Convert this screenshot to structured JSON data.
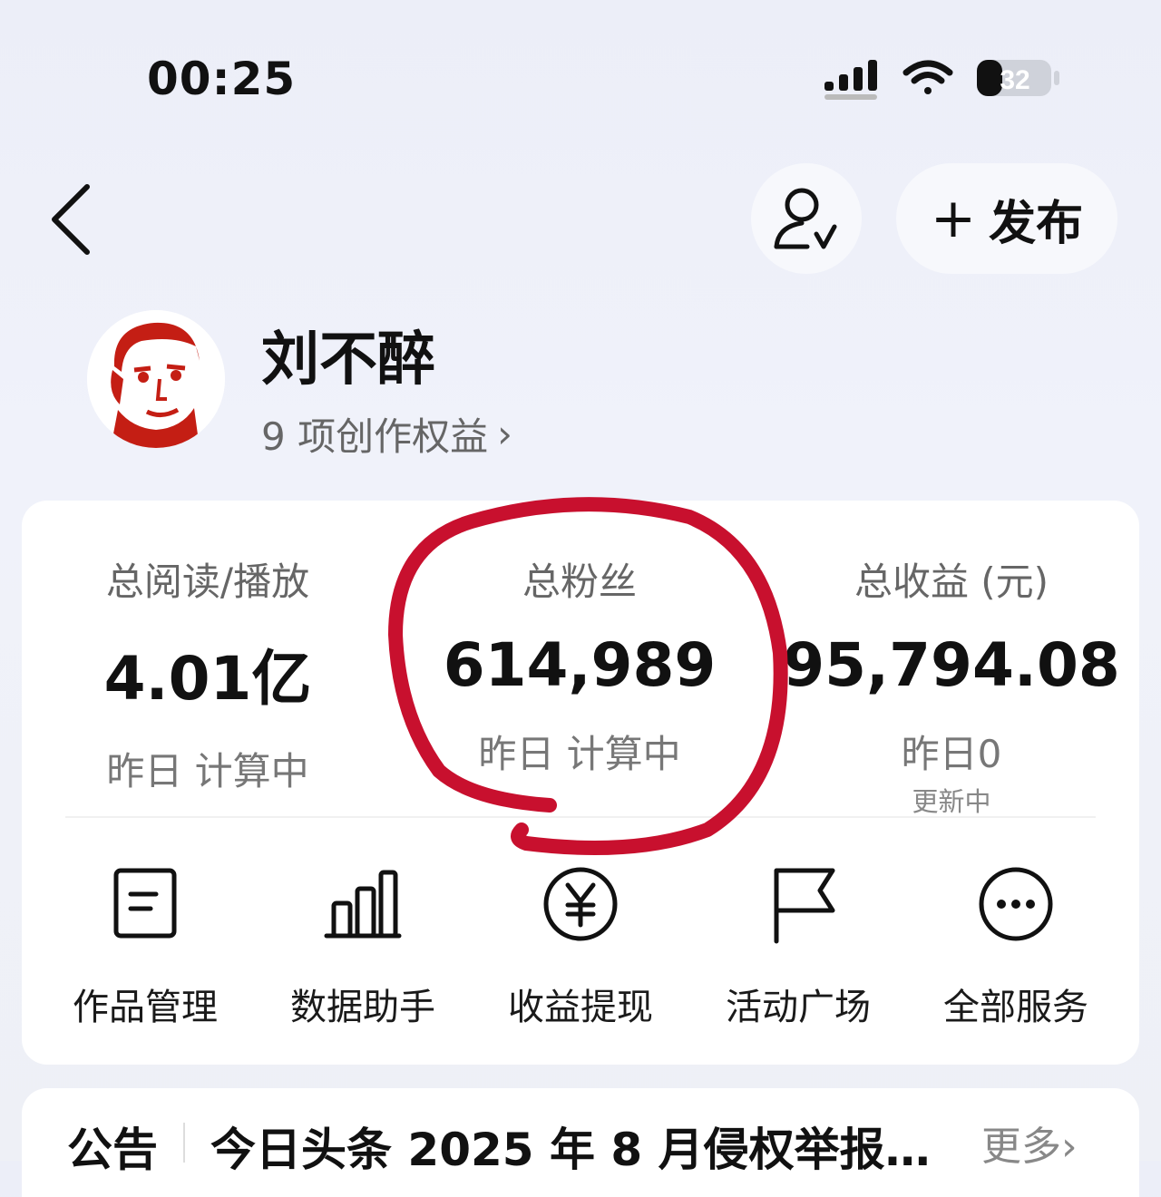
{
  "status_bar": {
    "time": "00:25",
    "battery": "32"
  },
  "header": {
    "publish_label": "发布",
    "publish_plus": "+"
  },
  "profile": {
    "name": "刘不醉",
    "rights_text": "9 项创作权益",
    "rights_chevron": "›"
  },
  "stats": [
    {
      "label": "总阅读/播放",
      "value": "4.01亿",
      "sub": "昨日 计算中",
      "sub2": ""
    },
    {
      "label": "总粉丝",
      "value": "614,989",
      "sub": "昨日 计算中",
      "sub2": ""
    },
    {
      "label": "总收益 (元)",
      "value": "95,794.08",
      "sub": "昨日0",
      "sub2": "更新中"
    }
  ],
  "services": [
    {
      "label": "作品管理",
      "icon": "document-icon"
    },
    {
      "label": "数据助手",
      "icon": "bar-chart-icon"
    },
    {
      "label": "收益提现",
      "icon": "yuan-coin-icon"
    },
    {
      "label": "活动广场",
      "icon": "flag-icon"
    },
    {
      "label": "全部服务",
      "icon": "more-dots-icon"
    }
  ],
  "notice": {
    "title": "公告",
    "text": "今日头条 2025 年 8 月侵权举报…",
    "more": "更多›"
  },
  "colors": {
    "annotation_red": "#c8102e",
    "background": "#eceef8",
    "card": "#ffffff"
  }
}
